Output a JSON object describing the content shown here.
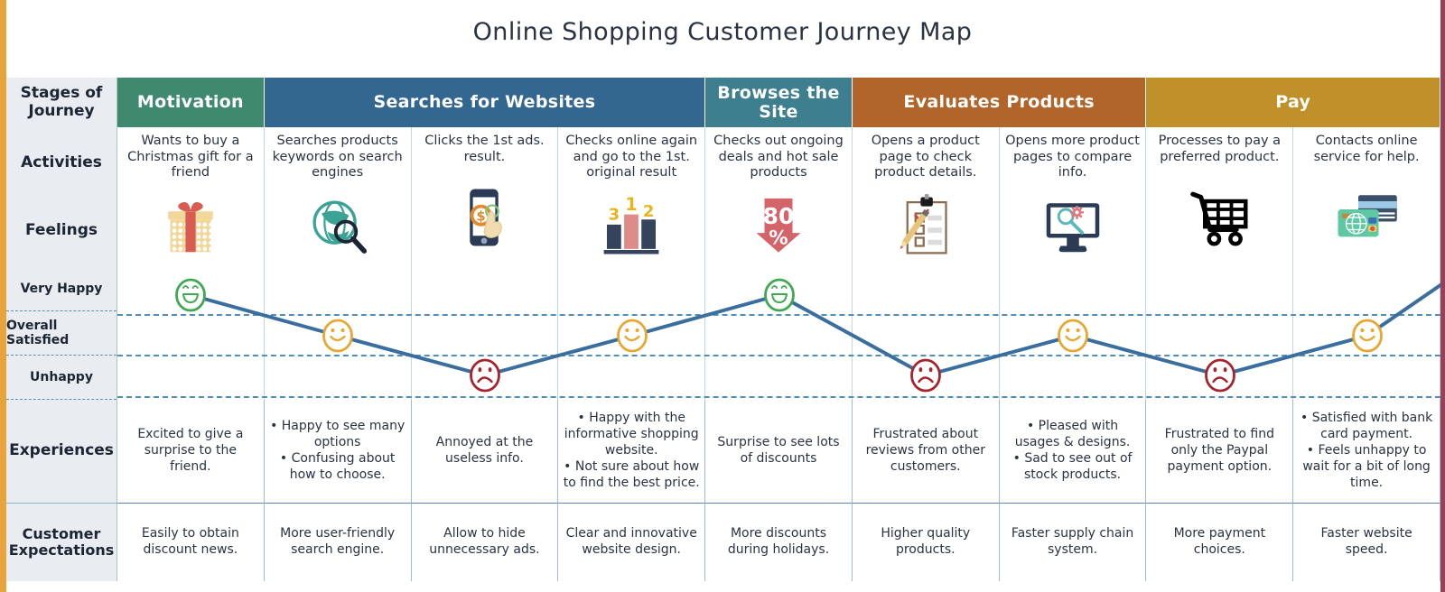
{
  "title": "Online Shopping Customer Journey Map",
  "row_labels": {
    "stages": "Stages of Journey",
    "activities": "Activities",
    "feelings": "Feelings",
    "experiences": "Experiences",
    "expectations": "Customer Expectations"
  },
  "feeling_levels": [
    "Very Happy",
    "Overall Satisfied",
    "Unhappy"
  ],
  "stages": [
    {
      "label": "Motivation",
      "color": "#3f8a6e",
      "span": 1
    },
    {
      "label": "Searches for Websites",
      "color": "#33678f",
      "span": 3
    },
    {
      "label": "Browses the Site",
      "color": "#3d7f8f",
      "span": 1
    },
    {
      "label": "Evaluates Products",
      "color": "#b2652a",
      "span": 2
    },
    {
      "label": "Pay",
      "color": "#c0912a",
      "span": 2
    }
  ],
  "columns": [
    {
      "activity": "Wants to buy a Christmas gift for a friend",
      "icon": "gift-box-icon",
      "feeling": "Very Happy",
      "feeling_color": "#3fa952",
      "experience": [
        "Excited to give a surprise to the friend."
      ],
      "expectation": "Easily to obtain discount news."
    },
    {
      "activity": "Searches products keywords on search engines",
      "icon": "globe-search-icon",
      "feeling": "Overall Satisfied",
      "feeling_color": "#e8a633",
      "experience": [
        "Happy to see many options",
        "Confusing about how to choose."
      ],
      "expectation": "More user-friendly search engine."
    },
    {
      "activity": "Clicks the 1st ads. result.",
      "icon": "phone-payment-tap-icon",
      "feeling": "Unhappy",
      "feeling_color": "#a8232c",
      "experience": [
        "Annoyed at the useless info."
      ],
      "expectation": "Allow to hide unnecessary ads."
    },
    {
      "activity": "Checks online again and go to the 1st. original result",
      "icon": "ranking-bar-chart-icon",
      "feeling": "Overall Satisfied",
      "feeling_color": "#e8a633",
      "experience": [
        "Happy with the informative shopping website.",
        "Not sure about how to find the best price."
      ],
      "expectation": "Clear and innovative website design."
    },
    {
      "activity": "Checks out ongoing deals and hot sale products",
      "icon": "discount-80-percent-arrow-icon",
      "feeling": "Very Happy",
      "feeling_color": "#3fa952",
      "experience": [
        "Surprise to see lots of discounts"
      ],
      "expectation": "More discounts during holidays."
    },
    {
      "activity": "Opens a product page to check product details.",
      "icon": "clipboard-checklist-pencil-icon",
      "feeling": "Unhappy",
      "feeling_color": "#a8232c",
      "experience": [
        "Frustrated about reviews from other customers."
      ],
      "expectation": "Higher quality products."
    },
    {
      "activity": "Opens more product pages to compare info.",
      "icon": "monitor-search-icon",
      "feeling": "Overall Satisfied",
      "feeling_color": "#e8a633",
      "experience": [
        "Pleased with usages & designs.",
        "Sad to see out of stock products."
      ],
      "expectation": "Faster supply chain system."
    },
    {
      "activity": "Processes to pay a preferred product.",
      "icon": "shopping-cart-icon",
      "feeling": "Unhappy",
      "feeling_color": "#a8232c",
      "experience": [
        "Frustrated to find only the Paypal payment option."
      ],
      "expectation": "More payment choices."
    },
    {
      "activity": "Contacts online service for help.",
      "icon": "credit-cards-icon",
      "feeling": "Overall Satisfied",
      "feeling_color": "#e8a633",
      "experience": [
        "Satisfied with bank card payment.",
        "Feels unhappy to wait for a bit of long time."
      ],
      "expectation": "Faster website speed."
    }
  ],
  "chart_data": {
    "type": "line",
    "title": "Customer Feelings across Journey Stages",
    "ylabel": "Feelings",
    "categories": [
      "Wants to buy a Christmas gift for a friend",
      "Searches products keywords on search engines",
      "Clicks the 1st ads. result.",
      "Checks online again and go to the 1st. original result",
      "Checks out ongoing deals and hot sale products",
      "Opens a product page to check product details.",
      "Opens more product pages to compare info.",
      "Processes to pay a preferred product.",
      "Contacts online service for help."
    ],
    "ytick_labels": [
      "Very Happy",
      "Overall Satisfied",
      "Unhappy"
    ],
    "values": [
      "Very Happy",
      "Overall Satisfied",
      "Unhappy",
      "Overall Satisfied",
      "Very Happy",
      "Unhappy",
      "Overall Satisfied",
      "Unhappy",
      "Overall Satisfied"
    ],
    "numeric_values": [
      3,
      2,
      1,
      2,
      3,
      1,
      2,
      1,
      2
    ],
    "ylim": [
      1,
      3
    ],
    "grid": true,
    "legend": "none",
    "line_color": "#3a6e9e"
  },
  "palette": {
    "accent_left": "#e8a33d",
    "accent_right": "#9a3f55",
    "label_bg": "#e9ecf0",
    "grid": "#9dbdd6",
    "happy": "#3fa952",
    "satisfied": "#e8a633",
    "unhappy": "#a8232c"
  }
}
